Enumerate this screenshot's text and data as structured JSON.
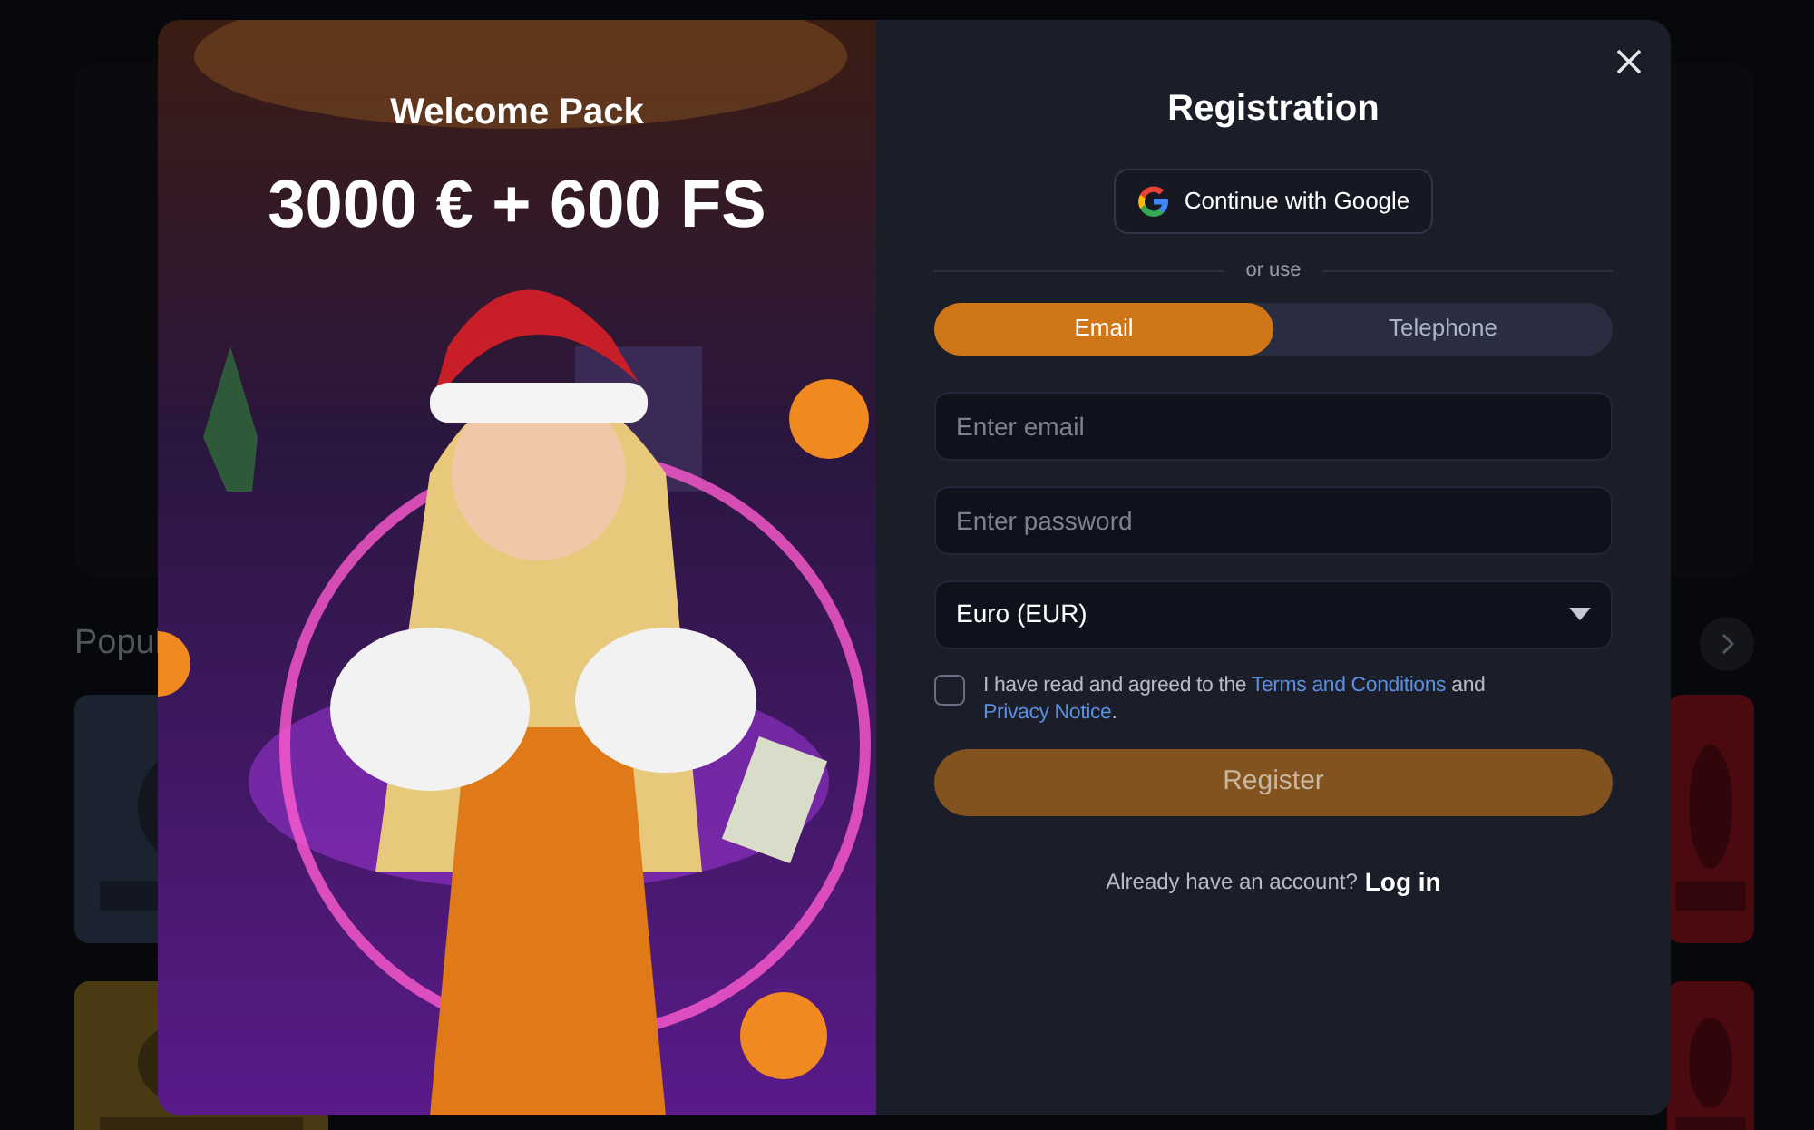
{
  "background_page": {
    "section_title": "Popul"
  },
  "promo": {
    "kind": "picture",
    "subtitle": "Welcome Pack",
    "headline": "3000 € + 600 FS"
  },
  "registration": {
    "title": "Registration",
    "google_button": "Continue with Google",
    "divider": "or use",
    "tabs": [
      {
        "label": "Email",
        "selected": true
      },
      {
        "label": "Telephone",
        "selected": false
      }
    ],
    "fields": [
      {
        "kind": "text",
        "placeholder": "Enter email"
      },
      {
        "kind": "password",
        "placeholder": "Enter password"
      },
      {
        "kind": "select",
        "value": "Euro (EUR)"
      }
    ],
    "consent": {
      "checked": false,
      "text_before": "I have read and agreed to the",
      "terms_link": "Terms and Conditions",
      "text_middle": "and",
      "privacy_link": "Privacy Notice",
      "text_after": "."
    },
    "register_button": {
      "label": "Register",
      "disabled": true
    },
    "login_prompt": "Already have an account?",
    "login_link": "Log in"
  }
}
